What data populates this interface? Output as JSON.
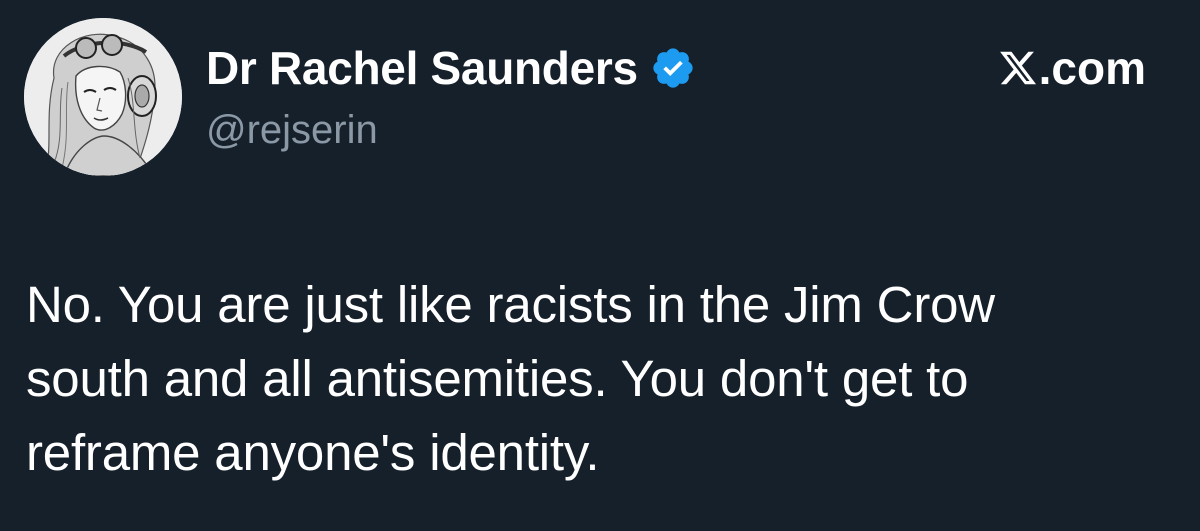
{
  "author": {
    "display_name": "Dr Rachel Saunders",
    "handle": "@rejserin",
    "verified": true,
    "avatar_icon": "sketch-portrait-avatar"
  },
  "brand": {
    "label": ".com",
    "logo_icon": "x-logo-icon"
  },
  "tweet": {
    "text": "No. You are just like racists in the Jim Crow\nsouth and all antisemities. You don't get to\nreframe anyone's identity."
  },
  "colors": {
    "background": "#15202b",
    "text_primary": "#ffffff",
    "text_secondary": "#8b98a5",
    "verified_blue": "#1d9bf0"
  }
}
